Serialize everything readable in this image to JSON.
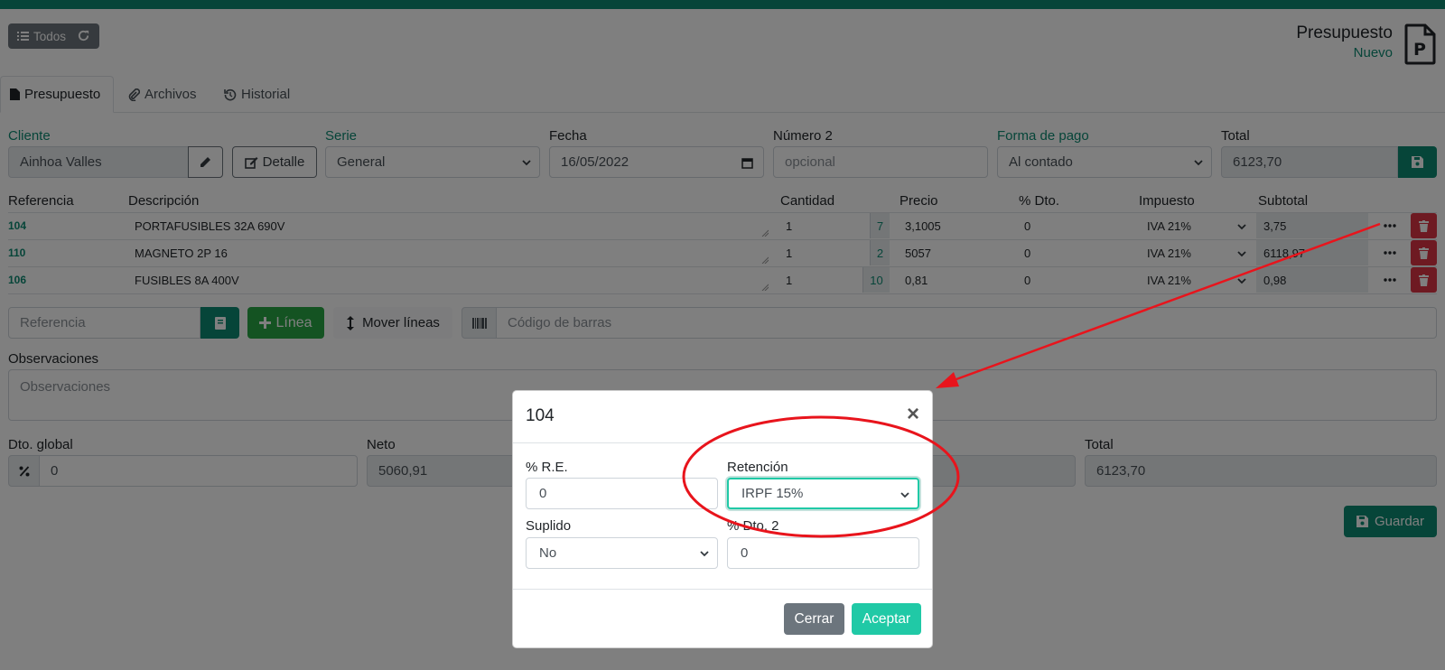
{
  "toolbar": {
    "todos_label": "Todos"
  },
  "document": {
    "title": "Presupuesto",
    "status": "Nuevo"
  },
  "tabs": [
    {
      "label": "Presupuesto",
      "icon": "file-icon"
    },
    {
      "label": "Archivos",
      "icon": "paperclip-icon"
    },
    {
      "label": "Historial",
      "icon": "history-icon"
    }
  ],
  "header_form": {
    "cliente_label": "Cliente",
    "cliente_value": "Ainhoa Valles",
    "detalle_label": "Detalle",
    "serie_label": "Serie",
    "serie_value": "General",
    "fecha_label": "Fecha",
    "fecha_value": "16/05/2022",
    "numero2_label": "Número 2",
    "numero2_placeholder": "opcional",
    "forma_pago_label": "Forma de pago",
    "forma_pago_value": "Al contado",
    "total_label": "Total",
    "total_value": "6123,70"
  },
  "lines_table": {
    "columns": [
      "Referencia",
      "Descripción",
      "Cantidad",
      "Precio",
      "% Dto.",
      "Impuesto",
      "Subtotal"
    ],
    "rows": [
      {
        "ref": "104",
        "desc": "PORTAFUSIBLES 32A 690V",
        "qty": "1",
        "stock": "7",
        "price": "3,1005",
        "dto": "0",
        "tax": "IVA 21%",
        "subtotal": "3,75"
      },
      {
        "ref": "110",
        "desc": "MAGNETO 2P 16",
        "qty": "1",
        "stock": "2",
        "price": "5057",
        "dto": "0",
        "tax": "IVA 21%",
        "subtotal": "6118,97"
      },
      {
        "ref": "106",
        "desc": "FUSIBLES 8A 400V",
        "qty": "1",
        "stock": "10",
        "price": "0,81",
        "dto": "0",
        "tax": "IVA 21%",
        "subtotal": "0,98"
      }
    ]
  },
  "add_line": {
    "referencia_placeholder": "Referencia",
    "linea_label": "Línea",
    "mover_label": "Mover líneas",
    "barcode_placeholder": "Código de barras"
  },
  "observaciones": {
    "label": "Observaciones",
    "placeholder": "Observaciones"
  },
  "totals": {
    "dto_global_label": "Dto. global",
    "dto_global_value": "0",
    "neto_label": "Neto",
    "neto_value": "5060,91",
    "total_label": "Total",
    "total_value": "6123,70",
    "guardar_label": "Guardar"
  },
  "modal": {
    "title": "104",
    "re_label": "% R.E.",
    "re_value": "0",
    "retencion_label": "Retención",
    "retencion_value": "IRPF 15%",
    "suplido_label": "Suplido",
    "suplido_value": "No",
    "dto2_label": "% Dto. 2",
    "dto2_value": "0",
    "cerrar_label": "Cerrar",
    "aceptar_label": "Aceptar"
  },
  "colors": {
    "accent": "#0d8a72",
    "success": "#28a745",
    "danger": "#dc3545",
    "modal_accept": "#20c9a6",
    "annotation": "#e8141c"
  }
}
